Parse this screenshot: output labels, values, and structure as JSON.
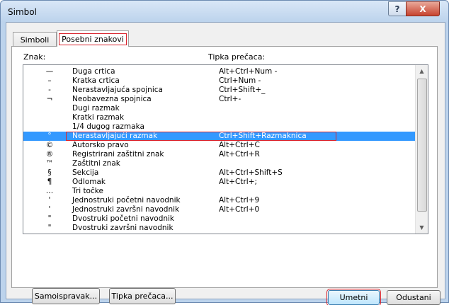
{
  "window": {
    "title": "Simbol",
    "help_glyph": "?",
    "close_glyph": "X"
  },
  "tabs": [
    {
      "label": "Simboli",
      "active": false
    },
    {
      "label": "Posebni znakovi",
      "active": true
    }
  ],
  "list": {
    "col_char": "Znak:",
    "col_key": "Tipka prečaca:",
    "selected_index": 7,
    "rows": [
      {
        "char": "—",
        "name": "Duga crtica",
        "shortcut": "Alt+Ctrl+Num -"
      },
      {
        "char": "–",
        "name": "Kratka crtica",
        "shortcut": "Ctrl+Num -"
      },
      {
        "char": "-",
        "name": "Nerastavljajuća spojnica",
        "shortcut": "Ctrl+Shift+_"
      },
      {
        "char": "¬",
        "name": "Neobavezna spojnica",
        "shortcut": "Ctrl+-"
      },
      {
        "char": "",
        "name": "Dugi razmak",
        "shortcut": ""
      },
      {
        "char": "",
        "name": "Kratki razmak",
        "shortcut": ""
      },
      {
        "char": "",
        "name": "1/4 dugog razmaka",
        "shortcut": ""
      },
      {
        "char": "°",
        "name": "Nerastavljajući razmak",
        "shortcut": "Ctrl+Shift+Razmaknica"
      },
      {
        "char": "©",
        "name": "Autorsko pravo",
        "shortcut": "Alt+Ctrl+C"
      },
      {
        "char": "®",
        "name": "Registrirani zaštitni znak",
        "shortcut": "Alt+Ctrl+R"
      },
      {
        "char": "™",
        "name": "Zaštitni znak",
        "shortcut": ""
      },
      {
        "char": "§",
        "name": "Sekcija",
        "shortcut": "Alt+Ctrl+Shift+S"
      },
      {
        "char": "¶",
        "name": "Odlomak",
        "shortcut": "Alt+Ctrl+;"
      },
      {
        "char": "…",
        "name": "Tri točke",
        "shortcut": ""
      },
      {
        "char": "'",
        "name": "Jednostruki početni navodnik",
        "shortcut": "Alt+Ctrl+9"
      },
      {
        "char": "'",
        "name": "Jednostruki završni navodnik",
        "shortcut": "Alt+Ctrl+0"
      },
      {
        "char": "\"",
        "name": "Dvostruki početni navodnik",
        "shortcut": ""
      },
      {
        "char": "\"",
        "name": "Dvostruki završni navodnik",
        "shortcut": ""
      }
    ]
  },
  "buttons": {
    "autocorrect": "Samoispravak...",
    "shortcut_key": "Tipka prečaca...",
    "insert": "Umetni",
    "cancel": "Odustani"
  },
  "scrollbar": {
    "up_glyph": "▲",
    "down_glyph": "▼"
  }
}
